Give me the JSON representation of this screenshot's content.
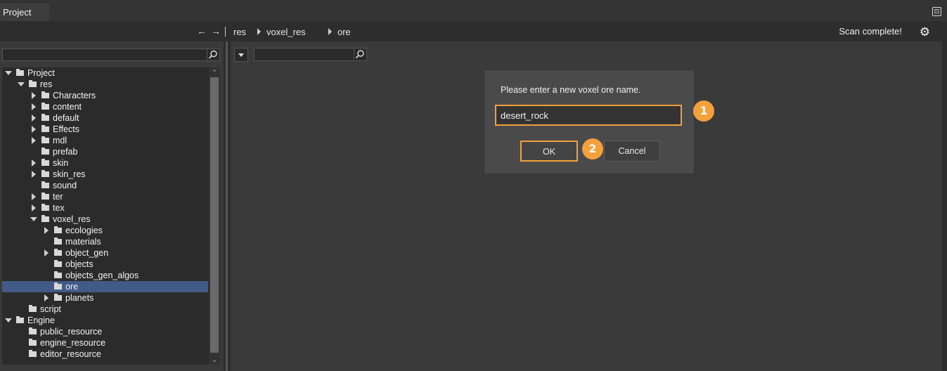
{
  "window": {
    "tab_title": "Project",
    "pin_icon": "pin-icon"
  },
  "toolbar": {
    "back_icon": "←",
    "forward_icon": "→",
    "breadcrumb": [
      "res",
      "voxel_res",
      "ore"
    ],
    "status": "Scan complete!",
    "settings_icon": "⚙"
  },
  "left_search": {
    "placeholder": ""
  },
  "tree": [
    {
      "label": "Project",
      "depth": 0,
      "toggle": "open"
    },
    {
      "label": "res",
      "depth": 1,
      "toggle": "open"
    },
    {
      "label": "Characters",
      "depth": 2,
      "toggle": "closed"
    },
    {
      "label": "content",
      "depth": 2,
      "toggle": "closed"
    },
    {
      "label": "default",
      "depth": 2,
      "toggle": "closed"
    },
    {
      "label": "Effects",
      "depth": 2,
      "toggle": "closed"
    },
    {
      "label": "mdl",
      "depth": 2,
      "toggle": "closed"
    },
    {
      "label": "prefab",
      "depth": 2,
      "toggle": "none"
    },
    {
      "label": "skin",
      "depth": 2,
      "toggle": "closed"
    },
    {
      "label": "skin_res",
      "depth": 2,
      "toggle": "closed"
    },
    {
      "label": "sound",
      "depth": 2,
      "toggle": "none"
    },
    {
      "label": "ter",
      "depth": 2,
      "toggle": "closed"
    },
    {
      "label": "tex",
      "depth": 2,
      "toggle": "closed"
    },
    {
      "label": "voxel_res",
      "depth": 2,
      "toggle": "open"
    },
    {
      "label": "ecologies",
      "depth": 3,
      "toggle": "closed"
    },
    {
      "label": "materials",
      "depth": 3,
      "toggle": "none"
    },
    {
      "label": "object_gen",
      "depth": 3,
      "toggle": "closed"
    },
    {
      "label": "objects",
      "depth": 3,
      "toggle": "none"
    },
    {
      "label": "objects_gen_algos",
      "depth": 3,
      "toggle": "none"
    },
    {
      "label": "ore",
      "depth": 3,
      "toggle": "none",
      "selected": true
    },
    {
      "label": "planets",
      "depth": 3,
      "toggle": "closed"
    },
    {
      "label": "script",
      "depth": 1,
      "toggle": "none"
    },
    {
      "label": "Engine",
      "depth": 0,
      "toggle": "open"
    },
    {
      "label": "public_resource",
      "depth": 1,
      "toggle": "none"
    },
    {
      "label": "engine_resource",
      "depth": 1,
      "toggle": "none"
    },
    {
      "label": "editor_resource",
      "depth": 1,
      "toggle": "none"
    }
  ],
  "dialog": {
    "prompt": "Please enter a new voxel ore name.",
    "input_value": "desert_rock",
    "ok_label": "OK",
    "cancel_label": "Cancel"
  },
  "callouts": [
    "1",
    "2"
  ],
  "colors": {
    "accent": "#f4a03b",
    "selection": "#415a87"
  }
}
